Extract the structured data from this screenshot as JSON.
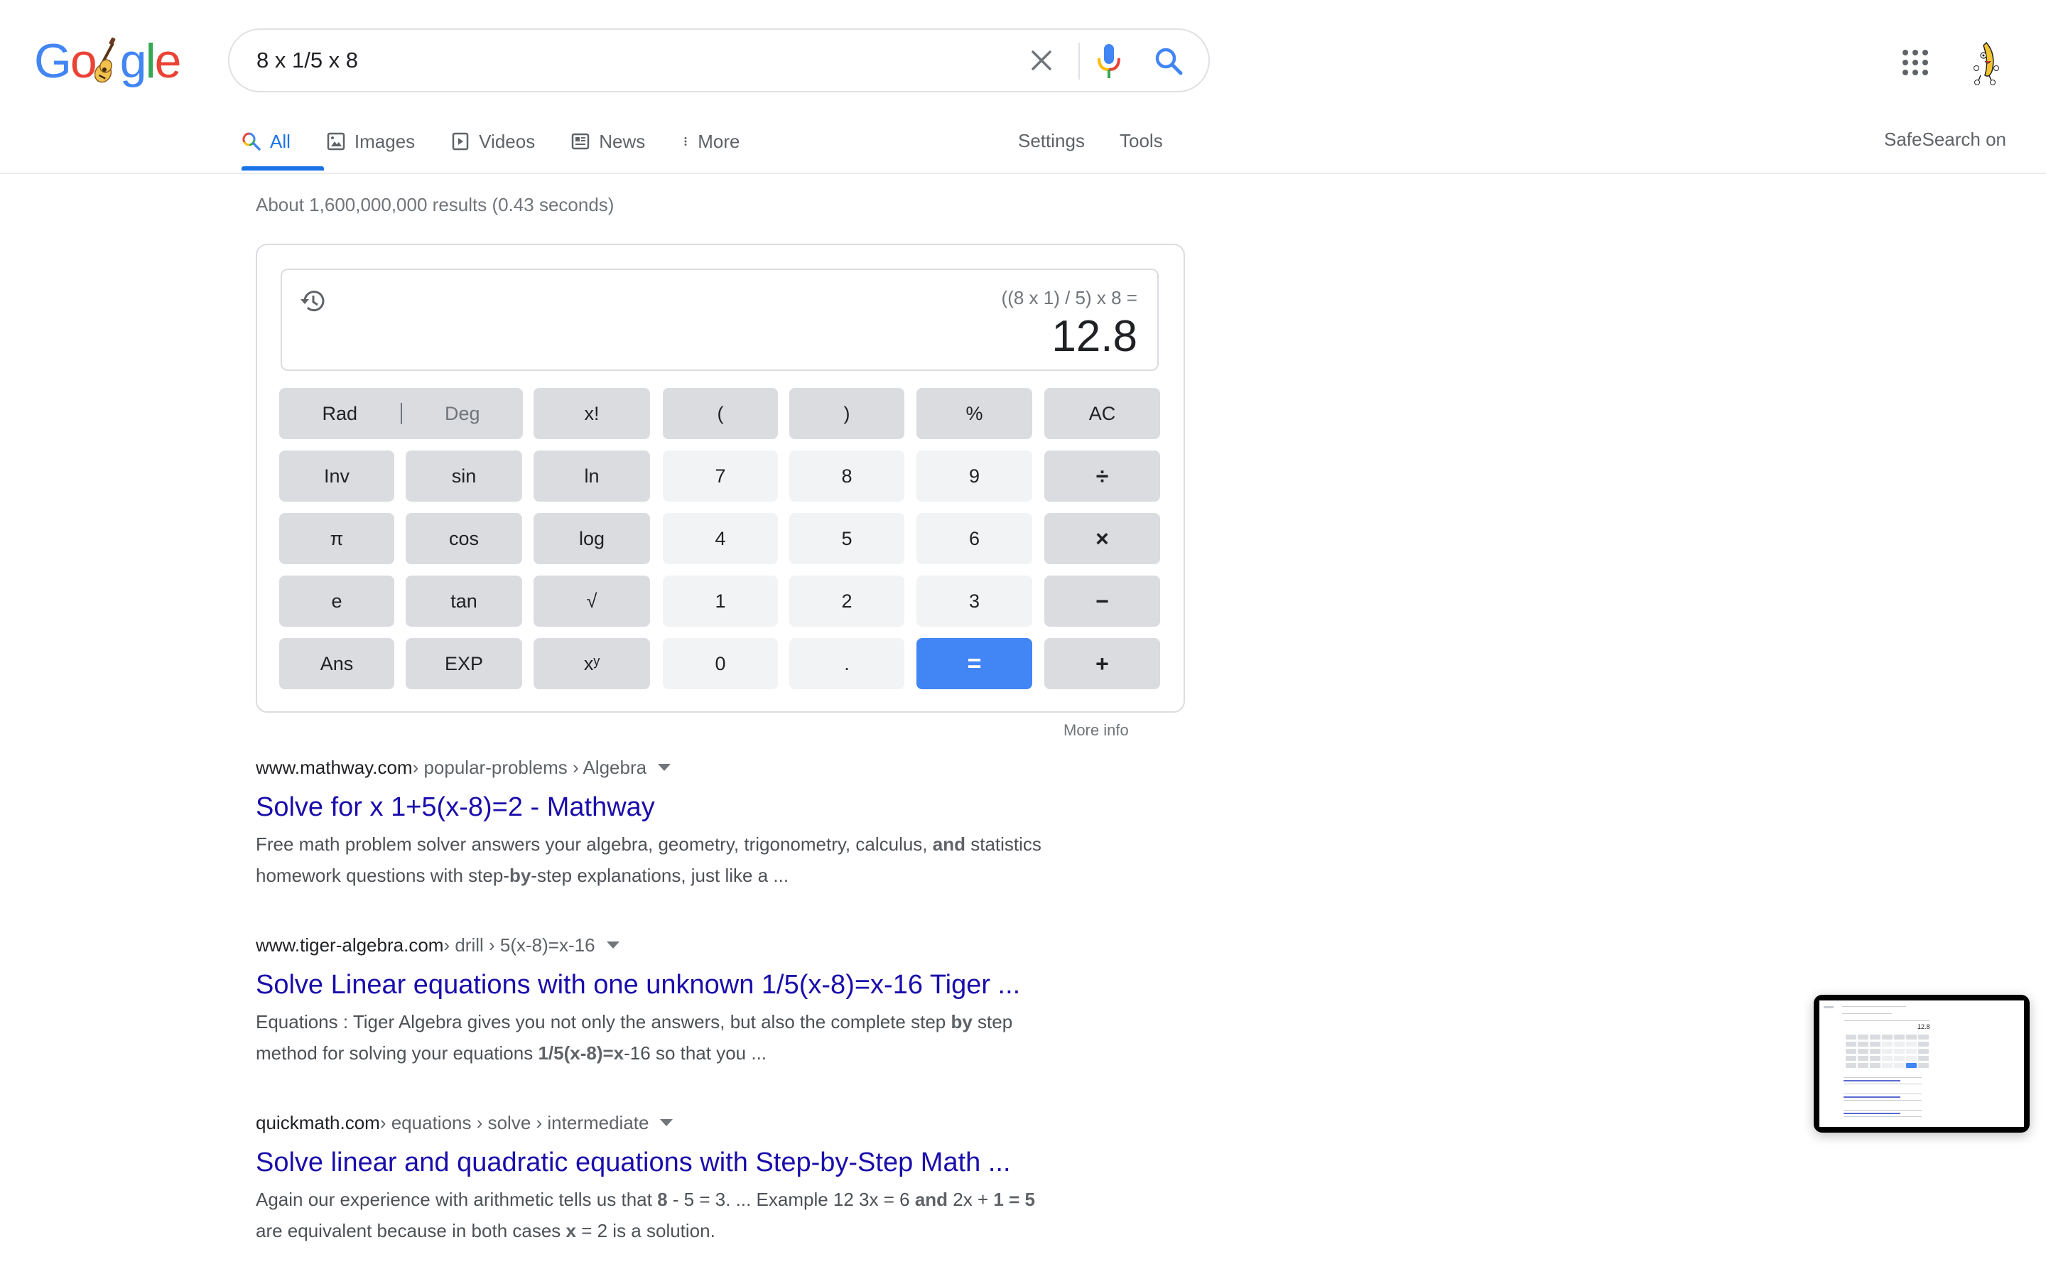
{
  "search": {
    "query": "8 x 1/5 x 8",
    "clear_label": "Clear",
    "voice_label": "Search by voice",
    "submit_label": "Google Search"
  },
  "logo": {
    "letters": [
      "G",
      "o",
      "g",
      "l",
      "e"
    ],
    "colors": {
      "blue": "#4285f4",
      "red": "#ea4335",
      "yellow": "#fbbc05",
      "green": "#34a853"
    }
  },
  "header": {
    "apps_label": "Google apps",
    "avatar_label": "Account"
  },
  "tabs": [
    {
      "label": "All",
      "icon": "search-icon",
      "active": true
    },
    {
      "label": "Images",
      "icon": "image-icon",
      "active": false
    },
    {
      "label": "Videos",
      "icon": "play-icon",
      "active": false
    },
    {
      "label": "News",
      "icon": "news-icon",
      "active": false
    },
    {
      "label": "More",
      "icon": "more-vert-icon",
      "active": false
    }
  ],
  "tools": {
    "settings": "Settings",
    "tools": "Tools",
    "safesearch": "SafeSearch on"
  },
  "result_stats": "About 1,600,000,000 results (0.43 seconds)",
  "calculator": {
    "expression": "((8 x 1) / 5) x 8 =",
    "result": "12.8",
    "angle_mode": {
      "rad": "Rad",
      "deg": "Deg",
      "selected": "Rad"
    },
    "rows": [
      [
        {
          "label": "x!",
          "kind": "fn"
        },
        {
          "label": "(",
          "kind": "fn"
        },
        {
          "label": ")",
          "kind": "fn"
        },
        {
          "label": "%",
          "kind": "fn"
        },
        {
          "label": "AC",
          "kind": "fn"
        }
      ],
      [
        {
          "label": "Inv",
          "kind": "fn"
        },
        {
          "label": "sin",
          "kind": "fn"
        },
        {
          "label": "ln",
          "kind": "fn"
        },
        {
          "label": "7",
          "kind": "num"
        },
        {
          "label": "8",
          "kind": "num"
        },
        {
          "label": "9",
          "kind": "num"
        },
        {
          "label": "÷",
          "kind": "op"
        }
      ],
      [
        {
          "label": "π",
          "kind": "fn"
        },
        {
          "label": "cos",
          "kind": "fn"
        },
        {
          "label": "log",
          "kind": "fn"
        },
        {
          "label": "4",
          "kind": "num"
        },
        {
          "label": "5",
          "kind": "num"
        },
        {
          "label": "6",
          "kind": "num"
        },
        {
          "label": "×",
          "kind": "op"
        }
      ],
      [
        {
          "label": "e",
          "kind": "fn"
        },
        {
          "label": "tan",
          "kind": "fn"
        },
        {
          "label": "√",
          "kind": "fn"
        },
        {
          "label": "1",
          "kind": "num"
        },
        {
          "label": "2",
          "kind": "num"
        },
        {
          "label": "3",
          "kind": "num"
        },
        {
          "label": "−",
          "kind": "op"
        }
      ],
      [
        {
          "label": "Ans",
          "kind": "fn"
        },
        {
          "label": "EXP",
          "kind": "fn"
        },
        {
          "label": "xʸ",
          "kind": "fn"
        },
        {
          "label": "0",
          "kind": "num"
        },
        {
          "label": ".",
          "kind": "num"
        },
        {
          "label": "=",
          "kind": "eq"
        },
        {
          "label": "+",
          "kind": "op"
        }
      ]
    ],
    "more_info": "More info",
    "accent_color": "#4285f4"
  },
  "results": [
    {
      "domain": "www.mathway.com",
      "crumbs": " › popular-problems › Algebra",
      "title": "Solve for x 1+5(x-8)=2 - Mathway",
      "snippet_html": "Free math problem solver answers your algebra, geometry, trigonometry, calculus, <b>and</b> statistics<br>homework questions with step-<b>by</b>-step explanations, just like a ..."
    },
    {
      "domain": "www.tiger-algebra.com",
      "crumbs": " › drill › 5(x-8)=x-16",
      "title": "Solve Linear equations with one unknown 1/5(x-8)=x-16 Tiger ...",
      "snippet_html": "Equations : Tiger Algebra gives you not only the answers, but also the complete step <b>by</b> step<br>method for solving your equations <b>1/5(x-8)=x</b>-16 so that you ..."
    },
    {
      "domain": "quickmath.com",
      "crumbs": " › equations › solve › intermediate",
      "title": "Solve linear and quadratic equations with Step-by-Step Math ...",
      "snippet_html": "Again our experience with arithmetic tells us that <b>8</b> - 5 = 3. ... Example 12 3x = 6 <b>and</b> 2x + <b>1 = 5</b><br>are equivalent because in both cases <b>x</b> = 2 is a solution."
    }
  ],
  "thumbnail": {
    "label": "Screenshot preview",
    "result": "12.8"
  }
}
